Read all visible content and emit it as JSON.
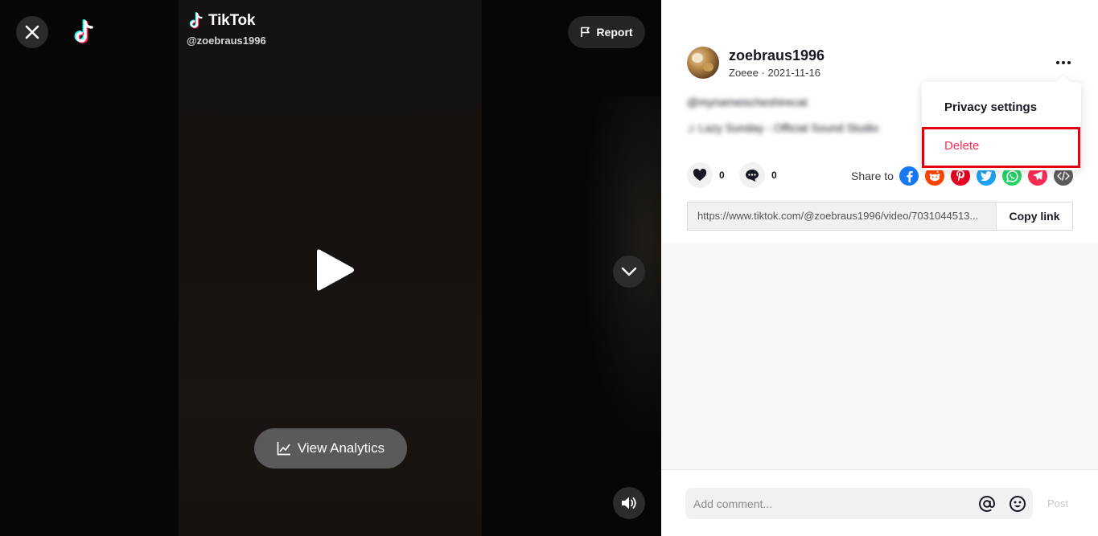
{
  "player": {
    "brand": "TikTok",
    "handle": "@zoebraus1996",
    "report_label": "Report",
    "analytics_label": "View Analytics"
  },
  "post": {
    "username": "zoebraus1996",
    "display_name": "Zoeee",
    "separator": " · ",
    "date": "2021-11-16",
    "caption": "@mynameischeshirecat",
    "sound": "Lazy Sunday - Official Sound Studio",
    "likes": "0",
    "comments": "0",
    "share_label": "Share to",
    "link": "https://www.tiktok.com/@zoebraus1996/video/7031044513...",
    "copy_label": "Copy link"
  },
  "menu": {
    "privacy_label": "Privacy settings",
    "delete_label": "Delete"
  },
  "comment_bar": {
    "placeholder": "Add comment...",
    "post_label": "Post"
  },
  "share_targets": [
    {
      "name": "facebook",
      "color": "#1877f2"
    },
    {
      "name": "reddit",
      "color": "#ff4500"
    },
    {
      "name": "pinterest",
      "color": "#e60023"
    },
    {
      "name": "twitter",
      "color": "#1da1f2"
    },
    {
      "name": "whatsapp",
      "color": "#25d366"
    },
    {
      "name": "telegram",
      "color": "#fe2c55"
    },
    {
      "name": "embed",
      "color": "#5c5c5c"
    }
  ],
  "colors": {
    "accent": "#fe2c55",
    "highlight": "#e4000f"
  }
}
